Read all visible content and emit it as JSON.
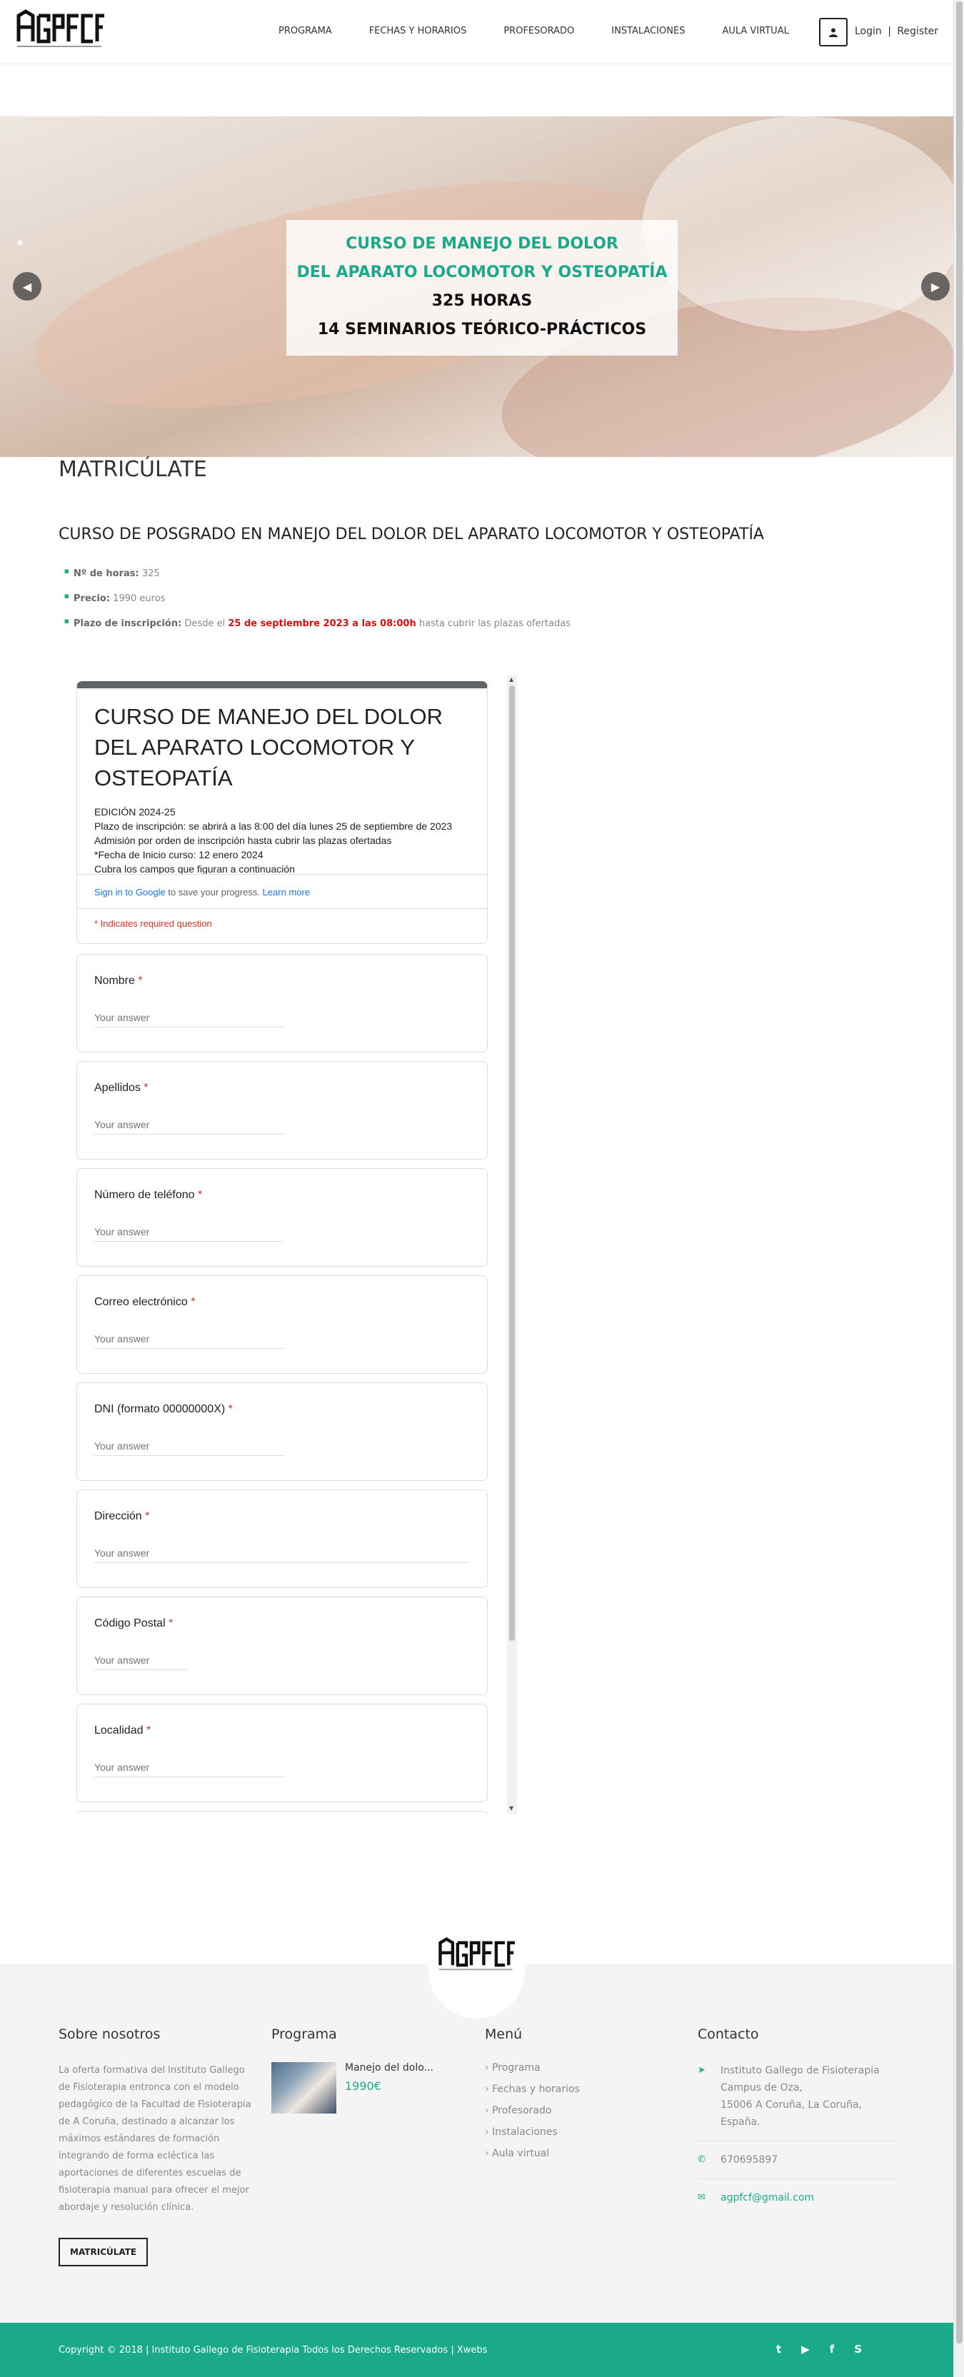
{
  "header": {
    "nav": [
      "PROGRAMA",
      "FECHAS Y HORARIOS",
      "PROFESORADO",
      "INSTALACIONES",
      "AULA VIRTUAL"
    ],
    "login": "Login",
    "separator": "|",
    "register": "Register"
  },
  "slider": {
    "line1": "CURSO DE MANEJO DEL DOLOR",
    "line2": "DEL APARATO LOCOMOTOR Y OSTEOPATÍA",
    "line3": "325 HORAS",
    "line4": "14 SEMINARIOS TEÓRICO-PRÁCTICOS"
  },
  "main": {
    "heading": "MATRICÚLATE",
    "course_title": "CURSO DE POSGRADO EN MANEJO DEL DOLOR DEL APARATO LOCOMOTOR Y OSTEOPATÍA",
    "hours_label": "Nº de horas:",
    "hours_value": "325",
    "price_label": "Precio:",
    "price_value": "1990 euros",
    "deadline_label": "Plazo de inscripción:",
    "deadline_pre": "Desde el",
    "deadline_date": "25 de septiembre 2023 a las 08:00h",
    "deadline_post": "hasta cubrir las plazas ofertadas"
  },
  "form": {
    "title": "CURSO DE MANEJO DEL DOLOR DEL APARATO LOCOMOTOR Y OSTEOPATÍA",
    "desc": [
      "EDICIÓN 2024-25",
      "Plazo de inscripción: se abrirá a las 8:00 del día lunes 25 de septiembre de 2023",
      "Admisión por orden de inscripción hasta cubrir las plazas ofertadas",
      "*Fecha de Inicio curso: 12 enero 2024",
      "Cubra los campos que figuran a continuación"
    ],
    "signin_link": "Sign in to Google",
    "signin_text": " to save your progress. ",
    "learn_more": "Learn more",
    "required_note": "* Indicates required question",
    "placeholder": "Your answer",
    "questions": [
      {
        "label": "Nombre"
      },
      {
        "label": "Apellidos"
      },
      {
        "label": "Número de teléfono"
      },
      {
        "label": "Correo electrónico"
      },
      {
        "label": "DNI (formato 00000000X)"
      },
      {
        "label": "Dirección"
      },
      {
        "label": "Código Postal"
      },
      {
        "label": "Localidad"
      }
    ]
  },
  "footer": {
    "about_title": "Sobre nosotros",
    "about_text": "La oferta formativa del Instituto Gallego de Fisioterapia entronca con el modelo pedagógico de la Facultad de Fisioterapia de A Coruña, destinado a alcanzar los máximos estándares de formación integrando de forma ecléctica las aportaciones de diferentes escuelas de fisioterapia manual para ofrecer el mejor abordaje y resolución clínica.",
    "enroll_button": "MATRICÚLATE",
    "program_title": "Programa",
    "program_item": "Manejo del dolo...",
    "program_price": "1990€",
    "menu_title": "Menú",
    "menu_items": [
      "Programa",
      "Fechas y horarios",
      "Profesorado",
      "Instalaciones",
      "Aula virtual"
    ],
    "contact_title": "Contacto",
    "address": [
      "Instituto Gallego de Fisioterapia",
      "Campus de Oza,",
      "15006 A Coruña, La Coruña,",
      "España."
    ],
    "phone": "670695897",
    "email": "agpfcf@gmail.com",
    "copyright": "Copyright © 2018 | Instituto Gallego de Fisioterapia Todos los Derechos Reservados | Xwebs"
  },
  "colors": {
    "accent": "#1aaa8a",
    "required": "#d93025",
    "link": "#1a73e8"
  }
}
